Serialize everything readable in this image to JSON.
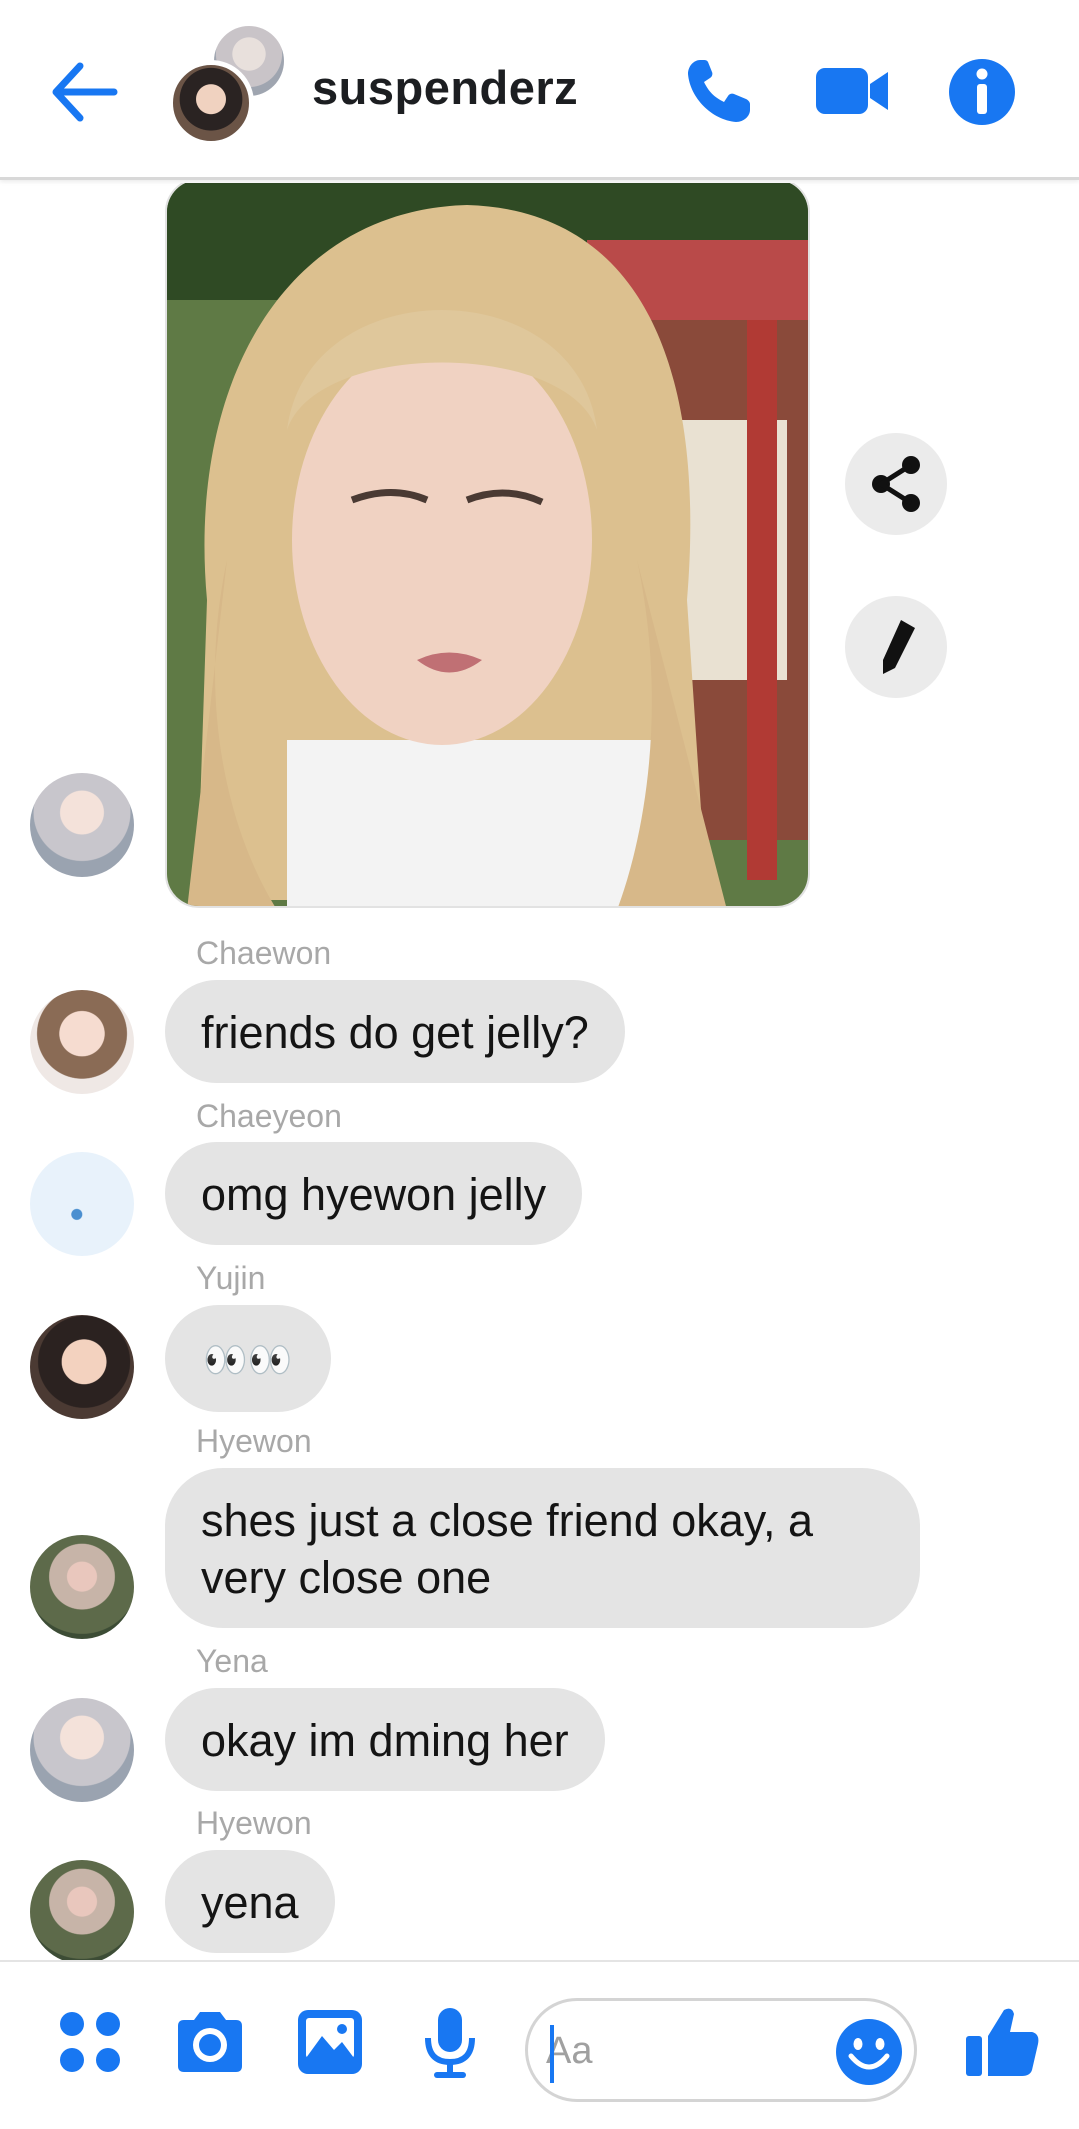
{
  "colors": {
    "accent": "#1877f2",
    "bubble": "#e4e4e4",
    "sender": "#a8a8a8"
  },
  "header": {
    "title": "suspenderz",
    "icons": [
      "back-arrow-icon",
      "phone-icon",
      "video-call-icon",
      "info-icon"
    ]
  },
  "messages": [
    {
      "sender": "Chaewon",
      "text": "friends do get jelly?"
    },
    {
      "sender": "Chaeyeon",
      "text": "omg hyewon jelly"
    },
    {
      "sender": "Yujin",
      "text": "👀👀"
    },
    {
      "sender": "Hyewon",
      "line1": "shes just a close friend okay, a",
      "line2": "very close one"
    },
    {
      "sender": "Yena",
      "text": "okay im dming her"
    },
    {
      "sender": "Hyewon",
      "text": "yena"
    }
  ],
  "image_actions": [
    "share-icon",
    "edit-icon"
  ],
  "composer": {
    "placeholder": "Aa",
    "icons": [
      "more-apps-icon",
      "camera-icon",
      "gallery-icon",
      "microphone-icon",
      "emoji-icon",
      "thumbs-up-icon"
    ]
  }
}
